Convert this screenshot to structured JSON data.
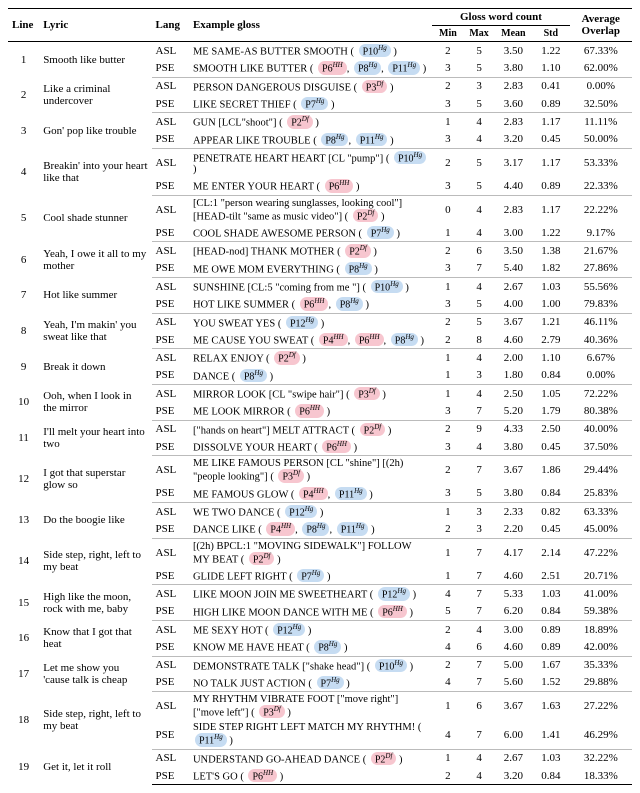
{
  "headers": {
    "line": "Line",
    "lyric": "Lyric",
    "lang": "Lang",
    "gloss": "Example gloss",
    "gloss_group": "Gloss word count",
    "min": "Min",
    "max": "Max",
    "mean": "Mean",
    "std": "Std",
    "overlap": "Average Overlap"
  },
  "rows": [
    {
      "line": 1,
      "lyric": "Smooth like butter",
      "variants": [
        {
          "lang": "ASL",
          "gloss": "ME SAME-AS BUTTER SMOOTH",
          "tags": [
            {
              "t": "P10",
              "s": "Hg",
              "c": "blue"
            }
          ],
          "min": 2,
          "max": 5,
          "mean": "3.50",
          "std": "1.22",
          "ovl": "67.33%"
        },
        {
          "lang": "PSE",
          "gloss": "SMOOTH LIKE BUTTER",
          "tags": [
            {
              "t": "P6",
              "s": "HH",
              "c": "pink"
            },
            {
              "t": "P8",
              "s": "Hg",
              "c": "blue"
            },
            {
              "t": "P11",
              "s": "Hg",
              "c": "blue"
            }
          ],
          "min": 3,
          "max": 5,
          "mean": "3.80",
          "std": "1.10",
          "ovl": "62.00%"
        }
      ]
    },
    {
      "line": 2,
      "lyric": "Like a criminal undercover",
      "variants": [
        {
          "lang": "ASL",
          "gloss": "PERSON DANGEROUS DISGUISE",
          "tags": [
            {
              "t": "P3",
              "s": "Df",
              "c": "pink"
            }
          ],
          "min": 2,
          "max": 3,
          "mean": "2.83",
          "std": "0.41",
          "ovl": "0.00%"
        },
        {
          "lang": "PSE",
          "gloss": "LIKE SECRET THIEF",
          "tags": [
            {
              "t": "P7",
              "s": "Hg",
              "c": "blue"
            }
          ],
          "min": 3,
          "max": 5,
          "mean": "3.60",
          "std": "0.89",
          "ovl": "32.50%"
        }
      ]
    },
    {
      "line": 3,
      "lyric": "Gon' pop like trouble",
      "variants": [
        {
          "lang": "ASL",
          "gloss": "GUN [LCL\"shoot\"]",
          "tags": [
            {
              "t": "P2",
              "s": "Df",
              "c": "pink"
            }
          ],
          "min": 1,
          "max": 4,
          "mean": "2.83",
          "std": "1.17",
          "ovl": "11.11%"
        },
        {
          "lang": "PSE",
          "gloss": "APPEAR LIKE TROUBLE",
          "tags": [
            {
              "t": "P8",
              "s": "Hg",
              "c": "blue"
            },
            {
              "t": "P11",
              "s": "Hg",
              "c": "blue"
            }
          ],
          "min": 3,
          "max": 4,
          "mean": "3.20",
          "std": "0.45",
          "ovl": "50.00%"
        }
      ]
    },
    {
      "line": 4,
      "lyric": "Breakin' into your heart like that",
      "variants": [
        {
          "lang": "ASL",
          "gloss": "PENETRATE HEART HEART [CL \"pump\"]",
          "tags": [
            {
              "t": "P10",
              "s": "Hg",
              "c": "blue"
            }
          ],
          "min": 2,
          "max": 5,
          "mean": "3.17",
          "std": "1.17",
          "ovl": "53.33%"
        },
        {
          "lang": "PSE",
          "gloss": "ME ENTER YOUR HEART",
          "tags": [
            {
              "t": "P6",
              "s": "HH",
              "c": "pink"
            }
          ],
          "min": 3,
          "max": 5,
          "mean": "4.40",
          "std": "0.89",
          "ovl": "22.33%"
        }
      ]
    },
    {
      "line": 5,
      "lyric": "Cool shade stunner",
      "variants": [
        {
          "lang": "ASL",
          "gloss": "[CL:1 \"person wearing sunglasses, looking cool\"] [HEAD-tilt \"same as music video\"]",
          "tags": [
            {
              "t": "P2",
              "s": "Df",
              "c": "pink"
            }
          ],
          "min": 0,
          "max": 4,
          "mean": "2.83",
          "std": "1.17",
          "ovl": "22.22%"
        },
        {
          "lang": "PSE",
          "gloss": "COOL SHADE AWESOME PERSON",
          "tags": [
            {
              "t": "P7",
              "s": "Hg",
              "c": "blue"
            }
          ],
          "min": 1,
          "max": 4,
          "mean": "3.00",
          "std": "1.22",
          "ovl": "9.17%"
        }
      ]
    },
    {
      "line": 6,
      "lyric": "Yeah, I owe it all to my mother",
      "variants": [
        {
          "lang": "ASL",
          "gloss": "[HEAD-nod] THANK MOTHER",
          "tags": [
            {
              "t": "P2",
              "s": "Df",
              "c": "pink"
            }
          ],
          "min": 2,
          "max": 6,
          "mean": "3.50",
          "std": "1.38",
          "ovl": "21.67%"
        },
        {
          "lang": "PSE",
          "gloss": "ME OWE MOM EVERYTHING",
          "tags": [
            {
              "t": "P8",
              "s": "Hg",
              "c": "blue"
            }
          ],
          "min": 3,
          "max": 7,
          "mean": "5.40",
          "std": "1.82",
          "ovl": "27.86%"
        }
      ]
    },
    {
      "line": 7,
      "lyric": "Hot like summer",
      "variants": [
        {
          "lang": "ASL",
          "gloss": "SUNSHINE [CL:5 \"coming from me \"]",
          "tags": [
            {
              "t": "P10",
              "s": "Hg",
              "c": "blue"
            }
          ],
          "min": 1,
          "max": 4,
          "mean": "2.67",
          "std": "1.03",
          "ovl": "55.56%"
        },
        {
          "lang": "PSE",
          "gloss": "HOT LIKE SUMMER",
          "tags": [
            {
              "t": "P6",
              "s": "HH",
              "c": "pink"
            },
            {
              "t": "P8",
              "s": "Hg",
              "c": "blue"
            }
          ],
          "min": 3,
          "max": 5,
          "mean": "4.00",
          "std": "1.00",
          "ovl": "79.83%"
        }
      ]
    },
    {
      "line": 8,
      "lyric": "Yeah, I'm makin' you sweat like that",
      "variants": [
        {
          "lang": "ASL",
          "gloss": "YOU SWEAT YES",
          "tags": [
            {
              "t": "P12",
              "s": "Hg",
              "c": "blue"
            }
          ],
          "min": 2,
          "max": 5,
          "mean": "3.67",
          "std": "1.21",
          "ovl": "46.11%"
        },
        {
          "lang": "PSE",
          "gloss": "ME CAUSE YOU SWEAT",
          "tags": [
            {
              "t": "P4",
              "s": "HH",
              "c": "pink"
            },
            {
              "t": "P6",
              "s": "HH",
              "c": "pink"
            },
            {
              "t": "P8",
              "s": "Hg",
              "c": "blue"
            }
          ],
          "min": 2,
          "max": 8,
          "mean": "4.60",
          "std": "2.79",
          "ovl": "40.36%"
        }
      ]
    },
    {
      "line": 9,
      "lyric": "Break it down",
      "variants": [
        {
          "lang": "ASL",
          "gloss": "RELAX ENJOY",
          "tags": [
            {
              "t": "P2",
              "s": "Df",
              "c": "pink"
            }
          ],
          "min": 1,
          "max": 4,
          "mean": "2.00",
          "std": "1.10",
          "ovl": "6.67%"
        },
        {
          "lang": "PSE",
          "gloss": "DANCE",
          "tags": [
            {
              "t": "P8",
              "s": "Hg",
              "c": "blue"
            }
          ],
          "min": 1,
          "max": 3,
          "mean": "1.80",
          "std": "0.84",
          "ovl": "0.00%"
        }
      ]
    },
    {
      "line": 10,
      "lyric": "Ooh, when I look in the mirror",
      "variants": [
        {
          "lang": "ASL",
          "gloss": "MIRROR LOOK [CL \"swipe hair\"]",
          "tags": [
            {
              "t": "P3",
              "s": "Df",
              "c": "pink"
            }
          ],
          "min": 1,
          "max": 4,
          "mean": "2.50",
          "std": "1.05",
          "ovl": "72.22%"
        },
        {
          "lang": "PSE",
          "gloss": "ME LOOK MIRROR",
          "tags": [
            {
              "t": "P6",
              "s": "HH",
              "c": "pink"
            }
          ],
          "min": 3,
          "max": 7,
          "mean": "5.20",
          "std": "1.79",
          "ovl": "80.38%"
        }
      ]
    },
    {
      "line": 11,
      "lyric": "I'll melt your heart into two",
      "variants": [
        {
          "lang": "ASL",
          "gloss": "[\"hands on heart\"] MELT ATTRACT",
          "tags": [
            {
              "t": "P2",
              "s": "Df",
              "c": "pink"
            }
          ],
          "min": 2,
          "max": 9,
          "mean": "4.33",
          "std": "2.50",
          "ovl": "40.00%"
        },
        {
          "lang": "PSE",
          "gloss": "DISSOLVE YOUR HEART",
          "tags": [
            {
              "t": "P6",
              "s": "HH",
              "c": "pink"
            }
          ],
          "min": 3,
          "max": 4,
          "mean": "3.80",
          "std": "0.45",
          "ovl": "37.50%"
        }
      ]
    },
    {
      "line": 12,
      "lyric": "I got that superstar glow so",
      "variants": [
        {
          "lang": "ASL",
          "gloss": "ME LIKE FAMOUS PERSON [CL \"shine\"] [(2h) \"people looking\"]",
          "tags": [
            {
              "t": "P3",
              "s": "Df",
              "c": "pink"
            }
          ],
          "min": 2,
          "max": 7,
          "mean": "3.67",
          "std": "1.86",
          "ovl": "29.44%"
        },
        {
          "lang": "PSE",
          "gloss": "ME FAMOUS GLOW",
          "tags": [
            {
              "t": "P4",
              "s": "HH",
              "c": "pink"
            },
            {
              "t": "P11",
              "s": "Hg",
              "c": "blue"
            }
          ],
          "min": 3,
          "max": 5,
          "mean": "3.80",
          "std": "0.84",
          "ovl": "25.83%"
        }
      ]
    },
    {
      "line": 13,
      "lyric": "Do the boogie like",
      "variants": [
        {
          "lang": "ASL",
          "gloss": "WE TWO DANCE",
          "tags": [
            {
              "t": "P12",
              "s": "Hg",
              "c": "blue"
            }
          ],
          "min": 1,
          "max": 3,
          "mean": "2.33",
          "std": "0.82",
          "ovl": "63.33%"
        },
        {
          "lang": "PSE",
          "gloss": "DANCE LIKE",
          "tags": [
            {
              "t": "P4",
              "s": "HH",
              "c": "pink"
            },
            {
              "t": "P8",
              "s": "Hg",
              "c": "blue"
            },
            {
              "t": "P11",
              "s": "Hg",
              "c": "blue"
            }
          ],
          "min": 2,
          "max": 3,
          "mean": "2.20",
          "std": "0.45",
          "ovl": "45.00%"
        }
      ]
    },
    {
      "line": 14,
      "lyric": "Side step, right, left to my beat",
      "variants": [
        {
          "lang": "ASL",
          "gloss": "[(2h) BPCL:1 \"MOVING SIDEWALK\"] FOLLOW MY BEAT",
          "tags": [
            {
              "t": "P2",
              "s": "Df",
              "c": "pink"
            }
          ],
          "min": 1,
          "max": 7,
          "mean": "4.17",
          "std": "2.14",
          "ovl": "47.22%"
        },
        {
          "lang": "PSE",
          "gloss": "GLIDE LEFT RIGHT",
          "tags": [
            {
              "t": "P7",
              "s": "Hg",
              "c": "blue"
            }
          ],
          "min": 1,
          "max": 7,
          "mean": "4.60",
          "std": "2.51",
          "ovl": "20.71%"
        }
      ]
    },
    {
      "line": 15,
      "lyric": "High like the moon, rock with me, baby",
      "variants": [
        {
          "lang": "ASL",
          "gloss": "LIKE MOON JOIN ME SWEETHEART",
          "tags": [
            {
              "t": "P12",
              "s": "Hg",
              "c": "blue"
            }
          ],
          "min": 4,
          "max": 7,
          "mean": "5.33",
          "std": "1.03",
          "ovl": "41.00%"
        },
        {
          "lang": "PSE",
          "gloss": "HIGH LIKE MOON DANCE WITH ME",
          "tags": [
            {
              "t": "P6",
              "s": "HH",
              "c": "pink"
            }
          ],
          "min": 5,
          "max": 7,
          "mean": "6.20",
          "std": "0.84",
          "ovl": "59.38%"
        }
      ]
    },
    {
      "line": 16,
      "lyric": "Know that I got that heat",
      "variants": [
        {
          "lang": "ASL",
          "gloss": "ME SEXY HOT",
          "tags": [
            {
              "t": "P12",
              "s": "Hg",
              "c": "blue"
            }
          ],
          "min": 2,
          "max": 4,
          "mean": "3.00",
          "std": "0.89",
          "ovl": "18.89%"
        },
        {
          "lang": "PSE",
          "gloss": "KNOW ME HAVE HEAT",
          "tags": [
            {
              "t": "P8",
              "s": "Hg",
              "c": "blue"
            }
          ],
          "min": 4,
          "max": 6,
          "mean": "4.60",
          "std": "0.89",
          "ovl": "42.00%"
        }
      ]
    },
    {
      "line": 17,
      "lyric": "Let me show you 'cause talk is cheap",
      "variants": [
        {
          "lang": "ASL",
          "gloss": "DEMONSTRATE TALK [\"shake head\"]",
          "tags": [
            {
              "t": "P10",
              "s": "Hg",
              "c": "blue"
            }
          ],
          "min": 2,
          "max": 7,
          "mean": "5.00",
          "std": "1.67",
          "ovl": "35.33%"
        },
        {
          "lang": "PSE",
          "gloss": "NO TALK JUST ACTION",
          "tags": [
            {
              "t": "P7",
              "s": "Hg",
              "c": "blue"
            }
          ],
          "min": 4,
          "max": 7,
          "mean": "5.60",
          "std": "1.52",
          "ovl": "29.88%"
        }
      ]
    },
    {
      "line": 18,
      "lyric": "Side step, right, left to my beat",
      "variants": [
        {
          "lang": "ASL",
          "gloss": "MY RHYTHM VIBRATE FOOT [\"move right\"][\"move left\"]",
          "tags": [
            {
              "t": "P3",
              "s": "Df",
              "c": "pink"
            }
          ],
          "min": 1,
          "max": 6,
          "mean": "3.67",
          "std": "1.63",
          "ovl": "27.22%"
        },
        {
          "lang": "PSE",
          "gloss": "SIDE STEP RIGHT LEFT MATCH MY RHYTHM!",
          "tags": [
            {
              "t": "P11",
              "s": "Hg",
              "c": "blue"
            }
          ],
          "min": 4,
          "max": 7,
          "mean": "6.00",
          "std": "1.41",
          "ovl": "46.29%"
        }
      ]
    },
    {
      "line": 19,
      "lyric": "Get it, let it roll",
      "variants": [
        {
          "lang": "ASL",
          "gloss": "UNDERSTAND GO-AHEAD DANCE",
          "tags": [
            {
              "t": "P2",
              "s": "Df",
              "c": "pink"
            }
          ],
          "min": 1,
          "max": 4,
          "mean": "2.67",
          "std": "1.03",
          "ovl": "32.22%"
        },
        {
          "lang": "PSE",
          "gloss": "LET'S GO",
          "tags": [
            {
              "t": "P6",
              "s": "HH",
              "c": "pink"
            }
          ],
          "min": 2,
          "max": 4,
          "mean": "3.20",
          "std": "0.84",
          "ovl": "18.33%"
        }
      ]
    }
  ]
}
